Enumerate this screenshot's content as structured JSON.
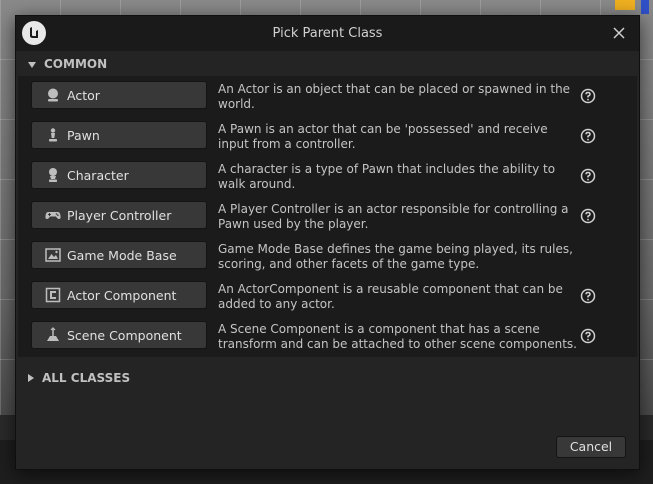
{
  "dialog": {
    "title": "Pick Parent Class",
    "common_header": "COMMON",
    "all_classes_header": "ALL CLASSES",
    "cancel_label": "Cancel",
    "close_icon": "close-icon",
    "logo_icon": "unreal-engine-logo"
  },
  "classes": [
    {
      "label": "Actor",
      "icon": "actor-icon",
      "description": "An Actor is an object that can be placed or spawned in the world."
    },
    {
      "label": "Pawn",
      "icon": "pawn-icon",
      "description": "A Pawn is an actor that can be 'possessed' and receive input from a controller."
    },
    {
      "label": "Character",
      "icon": "character-icon",
      "description": "A character is a type of Pawn that includes the ability to walk around."
    },
    {
      "label": "Player Controller",
      "icon": "gamepad-icon",
      "description": "A Player Controller is an actor responsible for controlling a Pawn used by the player."
    },
    {
      "label": "Game Mode Base",
      "icon": "game-mode-icon",
      "description": "Game Mode Base defines the game being played, its rules, scoring, and other facets of the game type."
    },
    {
      "label": "Actor Component",
      "icon": "actor-component-icon",
      "description": "An ActorComponent is a reusable component that can be added to any actor."
    },
    {
      "label": "Scene Component",
      "icon": "scene-component-icon",
      "description": "A Scene Component is a component that has a scene transform and can be attached to other scene components."
    }
  ]
}
